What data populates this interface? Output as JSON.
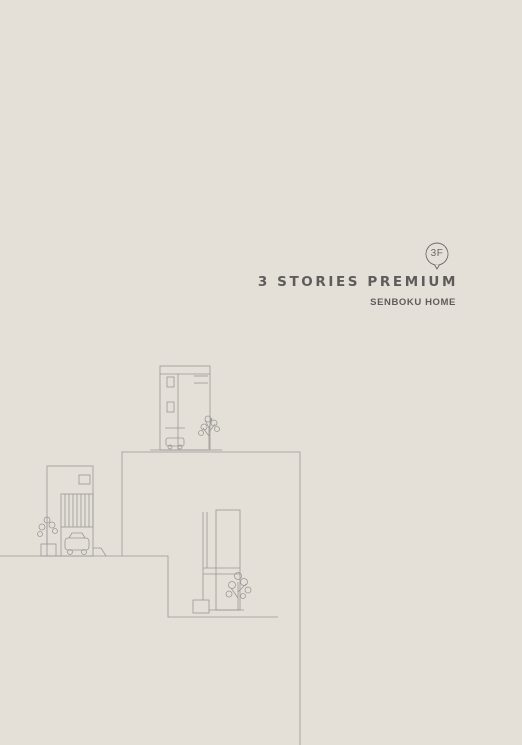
{
  "cover": {
    "badge": "3F",
    "title": "3 STORIES PREMIUM",
    "subtitle": "SENBOKU HOME",
    "colors": {
      "background": "#e4e0d8",
      "text": "#5e5c5a",
      "line": "#9a9794"
    }
  }
}
